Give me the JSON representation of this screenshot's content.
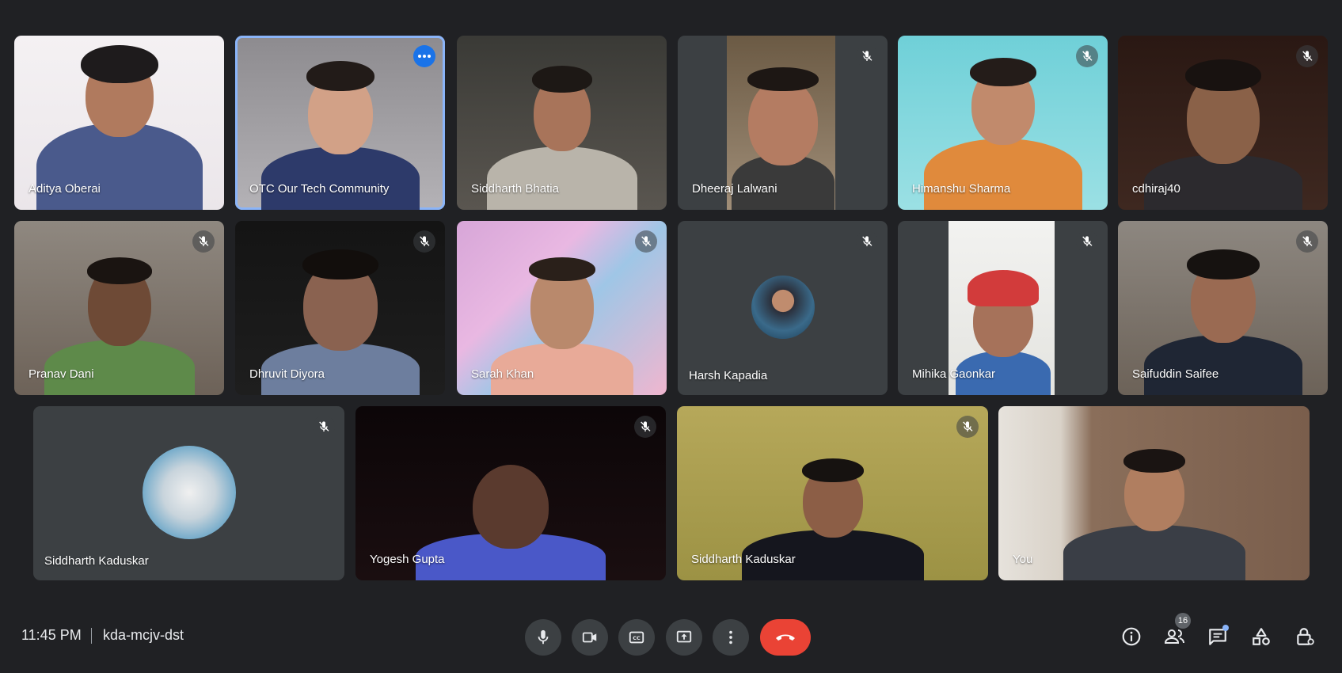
{
  "participants": [
    {
      "name": "Aditya Oberai"
    },
    {
      "name": "OTC Our Tech Community"
    },
    {
      "name": "Siddharth Bhatia"
    },
    {
      "name": "Dheeraj Lalwani"
    },
    {
      "name": "Himanshu Sharma"
    },
    {
      "name": "cdhiraj40"
    },
    {
      "name": "Pranav Dani"
    },
    {
      "name": "Dhruvit Diyora"
    },
    {
      "name": "Sarah Khan"
    },
    {
      "name": "Harsh Kapadia"
    },
    {
      "name": "Mihika Gaonkar"
    },
    {
      "name": "Saifuddin Saifee"
    },
    {
      "name": "Siddharth Kaduskar"
    },
    {
      "name": "Yogesh Gupta"
    },
    {
      "name": "Siddharth Kaduskar"
    },
    {
      "name": "You"
    }
  ],
  "meeting": {
    "time": "11:45 PM",
    "code": "kda-mcjv-dst",
    "participant_count": "16"
  },
  "colors": {
    "background": "#202124",
    "tile": "#3c4043",
    "active_outline": "#8ab4f8",
    "hangup": "#ea4335",
    "accent": "#1a73e8"
  },
  "icons": {
    "muted": "mic-off-icon",
    "more": "more-options-icon",
    "controls": [
      "mic-icon",
      "camera-icon",
      "captions-icon",
      "present-icon",
      "more-vert-icon",
      "hang-up-icon"
    ],
    "right": [
      "info-icon",
      "people-icon",
      "chat-icon",
      "activities-icon",
      "host-controls-icon"
    ]
  }
}
